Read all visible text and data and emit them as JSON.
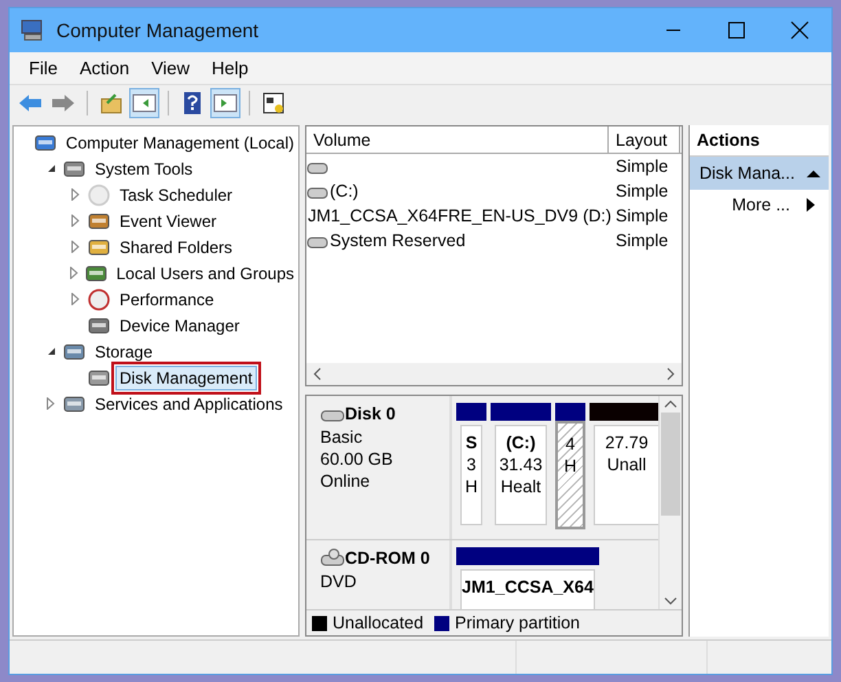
{
  "window": {
    "title": "Computer Management"
  },
  "menu": [
    "File",
    "Action",
    "View",
    "Help"
  ],
  "toolbar": [
    {
      "kind": "back",
      "pressed": false
    },
    {
      "kind": "forward",
      "pressed": false
    },
    {
      "kind": "sep"
    },
    {
      "kind": "up",
      "pressed": false
    },
    {
      "kind": "tree",
      "pressed": true
    },
    {
      "kind": "sep"
    },
    {
      "kind": "help",
      "pressed": false
    },
    {
      "kind": "actionpane",
      "pressed": true
    },
    {
      "kind": "sep"
    },
    {
      "kind": "props",
      "pressed": false
    }
  ],
  "tree": [
    {
      "label": "Computer Management (Local)",
      "selected": false,
      "children": [
        {
          "label": "System Tools",
          "expanded": true,
          "selected": false,
          "children": [
            {
              "label": "Task Scheduler",
              "expanded": false,
              "selected": false
            },
            {
              "label": "Event Viewer",
              "expanded": false,
              "selected": false
            },
            {
              "label": "Shared Folders",
              "expanded": false,
              "selected": false
            },
            {
              "label": "Local Users and Groups",
              "expanded": false,
              "selected": false
            },
            {
              "label": "Performance",
              "expanded": false,
              "selected": false
            },
            {
              "label": "Device Manager",
              "selected": false
            }
          ]
        },
        {
          "label": "Storage",
          "expanded": true,
          "selected": false,
          "children": [
            {
              "label": "Disk Management",
              "selected": true
            }
          ]
        },
        {
          "label": "Services and Applications",
          "expanded": false,
          "selected": false
        }
      ]
    }
  ],
  "volumes": {
    "columns": [
      "Volume",
      "Layout"
    ],
    "rows": [
      {
        "kind": "disk",
        "layout": "Simple"
      },
      {
        "kind": "disk",
        "name": "(C:)",
        "layout": "Simple"
      },
      {
        "kind": "cdrom",
        "name": "JM1_CCSA_X64FRE_EN-US_DV9 (D:)",
        "layout": "Simple"
      },
      {
        "kind": "disk",
        "name": "System Reserved",
        "layout": "Simple"
      }
    ]
  },
  "disks": [
    {
      "kind": "disk",
      "name": "Disk 0",
      "lines": [
        "Basic",
        "60.00 GB",
        "Online"
      ],
      "partitions": [
        {
          "kind": "primary",
          "selected": false,
          "lines": [
            "S",
            "3",
            "H"
          ]
        },
        {
          "kind": "primary",
          "selected": false,
          "lines": [
            "(C:)",
            "31.43",
            "Healt"
          ]
        },
        {
          "kind": "primary",
          "selected": true,
          "lines": [
            "4",
            "H"
          ]
        },
        {
          "kind": "unallocated",
          "selected": false,
          "lines": [
            "27.79",
            "Unall"
          ]
        }
      ]
    },
    {
      "kind": "cdrom",
      "name": "CD-ROM 0",
      "lines": [
        "DVD"
      ],
      "partitions": [
        {
          "kind": "primary",
          "selected": false,
          "lines": [
            "JM1_CCSA_X64"
          ]
        }
      ]
    }
  ],
  "legend": [
    {
      "label": "Unallocated",
      "color": "#000000"
    },
    {
      "label": "Primary partition",
      "color": "#000080"
    }
  ],
  "actions": {
    "title": "Actions",
    "section": "Disk Mana...",
    "items": [
      "More ..."
    ]
  }
}
